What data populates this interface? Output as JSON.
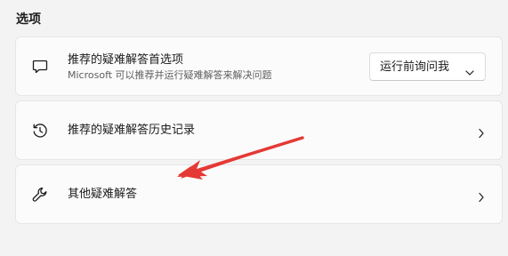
{
  "section": {
    "title": "选项"
  },
  "cards": [
    {
      "title": "推荐的疑难解答首选项",
      "subtitle": "Microsoft 可以推荐并运行疑难解答来解决问题",
      "icon": "chat-bubble-icon",
      "dropdown": {
        "value": "运行前询问我"
      }
    },
    {
      "title": "推荐的疑难解答历史记录",
      "icon": "history-icon"
    },
    {
      "title": "其他疑难解答",
      "icon": "wrench-icon"
    }
  ],
  "colors": {
    "background": "#f3f3f3",
    "card": "#fbfbfb",
    "annotation_arrow": "#e53935"
  }
}
